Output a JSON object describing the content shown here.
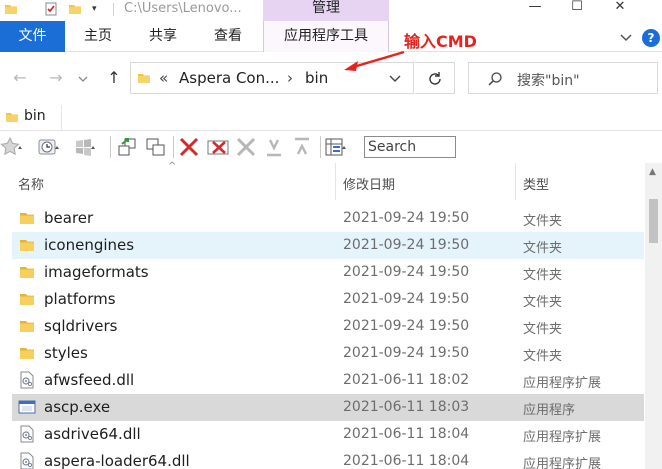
{
  "titlebar": {
    "path": "C:\\Users\\Lenovo...",
    "manage_tab": "管理",
    "minimize": "—",
    "maximize": "☐",
    "close": "✕"
  },
  "ribbon": {
    "tabs": [
      "文件",
      "主页",
      "共享",
      "查看"
    ],
    "tools_tab": "应用程序工具"
  },
  "annotation": {
    "text": "输入CMD",
    "color": "#e8231d"
  },
  "address": {
    "overflow": "«",
    "crumbs": [
      "Aspera Con...",
      "bin"
    ],
    "separator": "›",
    "search_placeholder": "搜索\"bin\""
  },
  "folder_tab": {
    "label": "bin"
  },
  "toolbar": {
    "search_placeholder": "Search"
  },
  "columns": {
    "name": "名称",
    "date": "修改日期",
    "type": "类型"
  },
  "files": [
    {
      "name": "bearer",
      "date": "2021-09-24 19:50",
      "type": "文件夹",
      "icon": "folder-icon",
      "state": ""
    },
    {
      "name": "iconengines",
      "date": "2021-09-24 19:50",
      "type": "文件夹",
      "icon": "folder-icon",
      "state": "hover"
    },
    {
      "name": "imageformats",
      "date": "2021-09-24 19:50",
      "type": "文件夹",
      "icon": "folder-icon",
      "state": ""
    },
    {
      "name": "platforms",
      "date": "2021-09-24 19:50",
      "type": "文件夹",
      "icon": "folder-icon",
      "state": ""
    },
    {
      "name": "sqldrivers",
      "date": "2021-09-24 19:50",
      "type": "文件夹",
      "icon": "folder-icon",
      "state": ""
    },
    {
      "name": "styles",
      "date": "2021-09-24 19:50",
      "type": "文件夹",
      "icon": "folder-icon",
      "state": ""
    },
    {
      "name": "afwsfeed.dll",
      "date": "2021-06-11 18:02",
      "type": "应用程序扩展",
      "icon": "dll-icon",
      "state": ""
    },
    {
      "name": "ascp.exe",
      "date": "2021-06-11 18:03",
      "type": "应用程序",
      "icon": "exe-icon",
      "state": "selected"
    },
    {
      "name": "asdrive64.dll",
      "date": "2021-06-11 18:04",
      "type": "应用程序扩展",
      "icon": "dll-icon",
      "state": ""
    },
    {
      "name": "aspera-loader64.dll",
      "date": "2021-06-11 18:04",
      "type": "应用程序扩展",
      "icon": "dll-icon",
      "state": ""
    }
  ],
  "colors": {
    "file_tab": "#1a6ed6",
    "manage_tab": "#e6d4f2",
    "folder": "#f2c443",
    "selected_row": "#d9d9d9",
    "hover_row": "#e5f3fb"
  }
}
